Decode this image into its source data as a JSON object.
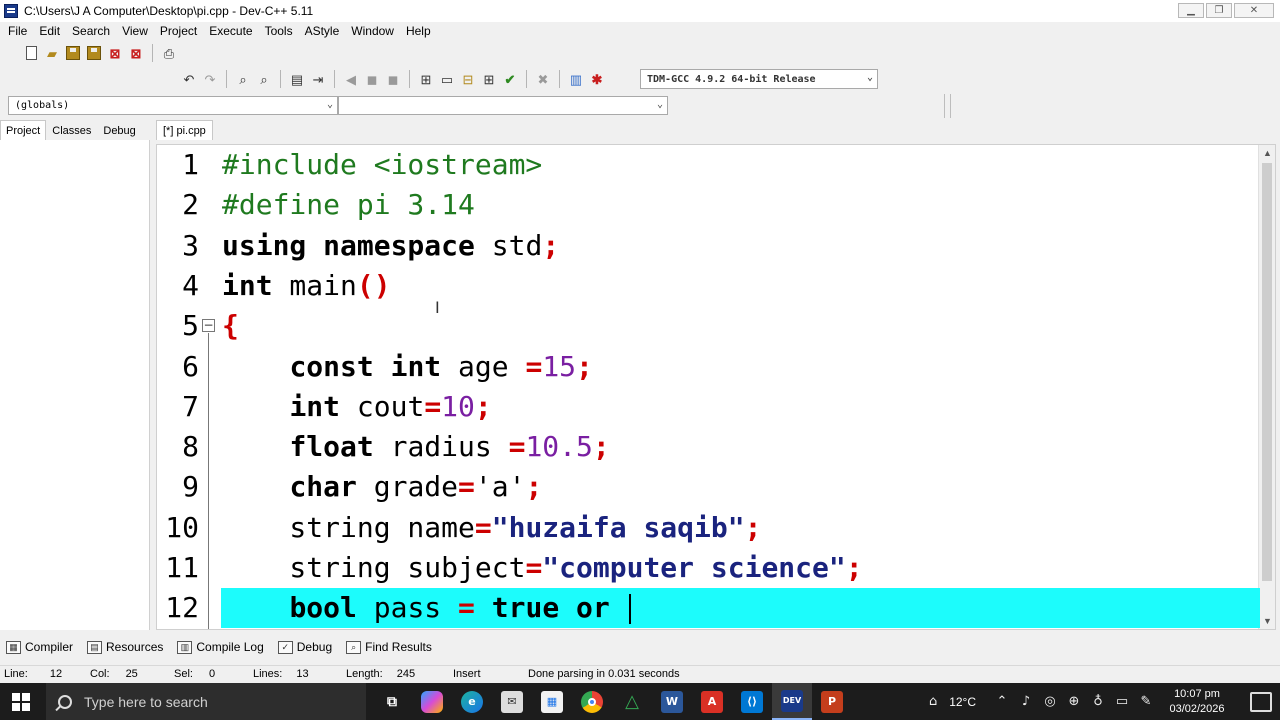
{
  "window": {
    "title": "C:\\Users\\J A Computer\\Desktop\\pi.cpp - Dev-C++ 5.11",
    "minimize": "▁",
    "restore": "❐",
    "close": "✕"
  },
  "menu": [
    "File",
    "Edit",
    "Search",
    "View",
    "Project",
    "Execute",
    "Tools",
    "AStyle",
    "Window",
    "Help"
  ],
  "toolbar": {
    "compiler": "TDM-GCC 4.9.2 64-bit Release"
  },
  "classbar": {
    "scope": "(globals)",
    "member": ""
  },
  "left_tabs": [
    "Project",
    "Classes",
    "Debug"
  ],
  "editor": {
    "tab": "[*] pi.cpp",
    "lines": [
      {
        "n": "1",
        "tokens": [
          [
            "pp",
            "#include <iostream>"
          ]
        ]
      },
      {
        "n": "2",
        "tokens": [
          [
            "pp",
            "#define pi 3.14"
          ]
        ]
      },
      {
        "n": "3",
        "tokens": [
          [
            "kw",
            "using namespace"
          ],
          [
            "plain",
            " std"
          ],
          [
            "sym",
            ";"
          ]
        ]
      },
      {
        "n": "4",
        "tokens": [
          [
            "kw",
            "int"
          ],
          [
            "plain",
            " main"
          ],
          [
            "sym",
            "()"
          ]
        ]
      },
      {
        "n": "5",
        "tokens": [
          [
            "sym",
            "{"
          ]
        ]
      },
      {
        "n": "6",
        "tokens": [
          [
            "plain",
            "    "
          ],
          [
            "kw",
            "const int"
          ],
          [
            "plain",
            " age "
          ],
          [
            "sym",
            "="
          ],
          [
            "num",
            "15"
          ],
          [
            "sym",
            ";"
          ]
        ]
      },
      {
        "n": "7",
        "tokens": [
          [
            "plain",
            "    "
          ],
          [
            "kw",
            "int"
          ],
          [
            "plain",
            " cout"
          ],
          [
            "sym",
            "="
          ],
          [
            "num",
            "10"
          ],
          [
            "sym",
            ";"
          ]
        ]
      },
      {
        "n": "8",
        "tokens": [
          [
            "plain",
            "    "
          ],
          [
            "kw",
            "float"
          ],
          [
            "plain",
            " radius "
          ],
          [
            "sym",
            "="
          ],
          [
            "num",
            "10.5"
          ],
          [
            "sym",
            ";"
          ]
        ]
      },
      {
        "n": "9",
        "tokens": [
          [
            "plain",
            "    "
          ],
          [
            "kw",
            "char"
          ],
          [
            "plain",
            " grade"
          ],
          [
            "sym",
            "="
          ],
          [
            "chr",
            "'a'"
          ],
          [
            "sym",
            ";"
          ]
        ]
      },
      {
        "n": "10",
        "tokens": [
          [
            "plain",
            "    string name"
          ],
          [
            "sym",
            "="
          ],
          [
            "str",
            "\"huzaifa saqib\""
          ],
          [
            "sym",
            ";"
          ]
        ]
      },
      {
        "n": "11",
        "tokens": [
          [
            "plain",
            "    string subject"
          ],
          [
            "sym",
            "="
          ],
          [
            "str",
            "\"computer science\""
          ],
          [
            "sym",
            ";"
          ]
        ]
      },
      {
        "n": "12",
        "tokens": [
          [
            "plain",
            "    "
          ],
          [
            "kw",
            "bool"
          ],
          [
            "plain",
            " pass "
          ],
          [
            "sym",
            "="
          ],
          [
            "plain",
            " "
          ],
          [
            "kw",
            "true"
          ],
          [
            "plain",
            " "
          ],
          [
            "kw",
            "or"
          ],
          [
            "plain",
            " "
          ]
        ]
      }
    ],
    "active_line": 12
  },
  "bottom_tabs": [
    {
      "label": "Compiler",
      "icon": "compiler-icon"
    },
    {
      "label": "Resources",
      "icon": "resources-icon"
    },
    {
      "label": "Compile Log",
      "icon": "compile-log-icon"
    },
    {
      "label": "Debug",
      "icon": "debug-icon"
    },
    {
      "label": "Find Results",
      "icon": "find-results-icon"
    }
  ],
  "status": {
    "line_label": "Line:",
    "line": "12",
    "col_label": "Col:",
    "col": "25",
    "sel_label": "Sel:",
    "sel": "0",
    "lines_label": "Lines:",
    "lines": "13",
    "length_label": "Length:",
    "length": "245",
    "mode": "Insert",
    "message": "Done parsing in 0.031 seconds"
  },
  "taskbar": {
    "search_placeholder": "Type here to search",
    "weather": "12°C",
    "time": "10:07 pm",
    "date": "03/02/2026"
  },
  "colors": {
    "active_line": "#1cfcfc",
    "preprocessor": "#1f7a1f",
    "symbol": "#cc0000",
    "number": "#7a1fa2",
    "string": "#1a237e"
  }
}
